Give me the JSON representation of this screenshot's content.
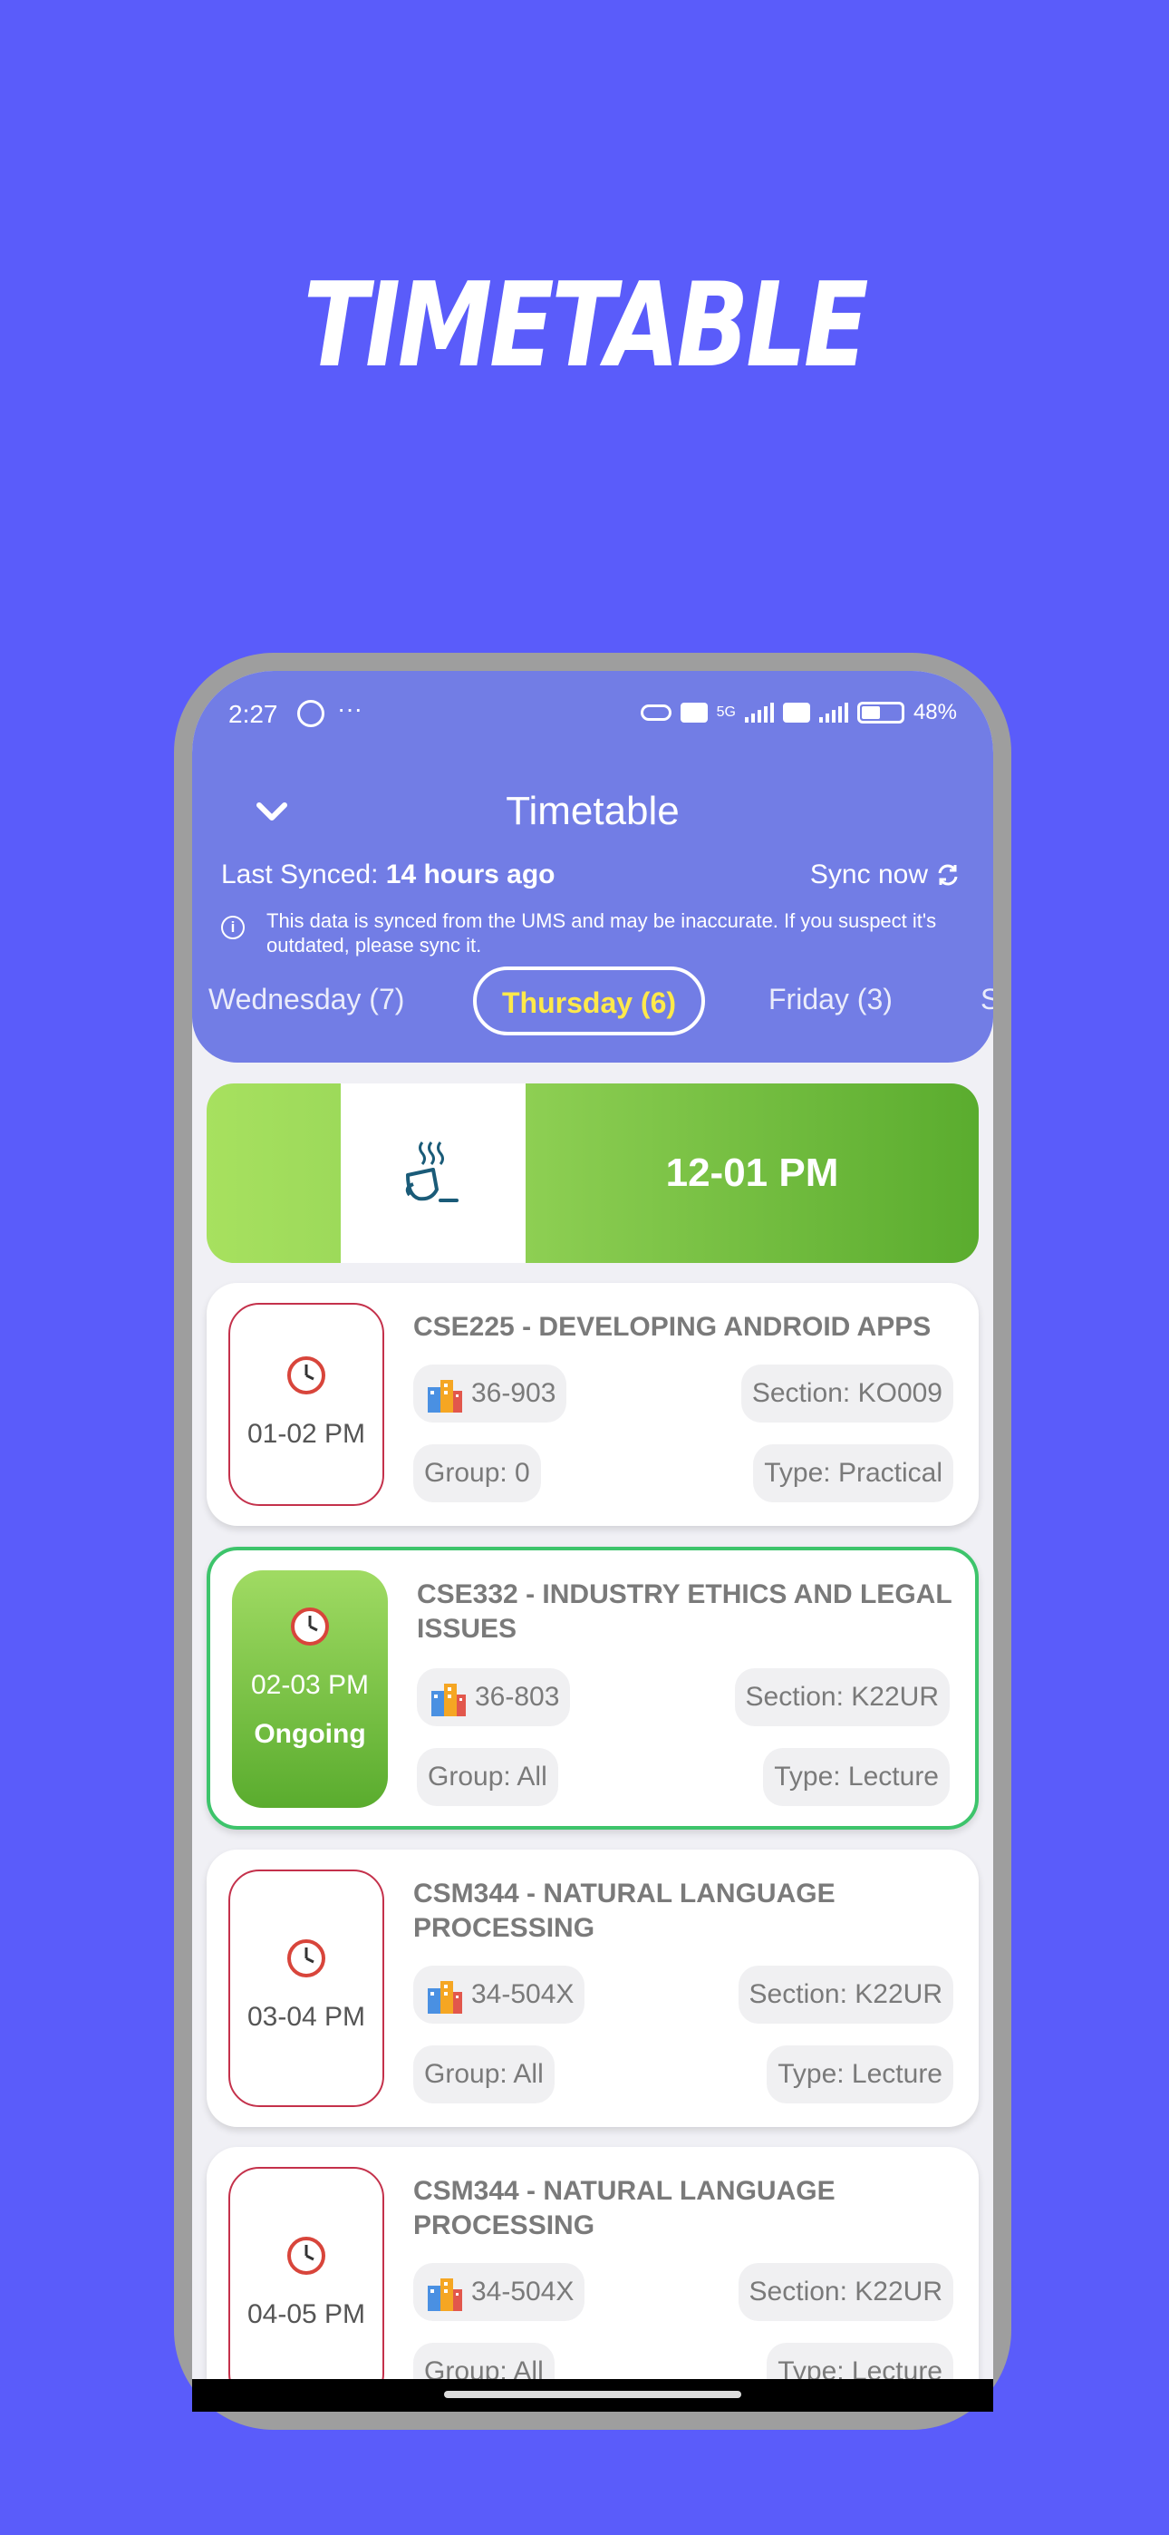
{
  "promo": {
    "title": "TIMETABLE"
  },
  "status_bar": {
    "time": "2:27",
    "dots": "···",
    "battery": "48%",
    "network": "5G"
  },
  "header": {
    "title": "Timetable",
    "sync_prefix": "Last Synced: ",
    "sync_value": "14 hours ago",
    "sync_now": "Sync now",
    "info": "This data is synced from the UMS and may be inaccurate. If you suspect it's outdated, please sync it."
  },
  "day_tabs": [
    {
      "label": "Wednesday (7)"
    },
    {
      "label": "Thursday (6)",
      "active": true
    },
    {
      "label": "Friday (3)"
    },
    {
      "label": "S"
    }
  ],
  "break_slot": {
    "time": "12-01 PM",
    "icon": "coffee-icon"
  },
  "classes": [
    {
      "time": "01-02 PM",
      "title": "CSE225 - DEVELOPING ANDROID APPS",
      "room": "36-903",
      "section": "Section: KO009",
      "group": "Group: 0",
      "type": "Type: Practical",
      "status": ""
    },
    {
      "time": "02-03 PM",
      "title": "CSE332 - INDUSTRY ETHICS AND LEGAL ISSUES",
      "room": "36-803",
      "section": "Section: K22UR",
      "group": "Group: All",
      "type": "Type: Lecture",
      "status": "Ongoing"
    },
    {
      "time": "03-04 PM",
      "title": "CSM344 - NATURAL LANGUAGE PROCESSING",
      "room": "34-504X",
      "section": "Section: K22UR",
      "group": "Group: All",
      "type": "Type: Lecture",
      "status": ""
    },
    {
      "time": "04-05 PM",
      "title": "CSM344 - NATURAL LANGUAGE PROCESSING",
      "room": "34-504X",
      "section": "Section: K22UR",
      "group": "Group: All",
      "type": "Type: Lecture",
      "status": ""
    }
  ],
  "colors": {
    "background": "#5a5cfa",
    "header": "#727de5",
    "active_tab": "#ffe94a",
    "ongoing_border": "#3dc46b",
    "time_border": "#c4314b",
    "break_green": "#5aac2e"
  }
}
